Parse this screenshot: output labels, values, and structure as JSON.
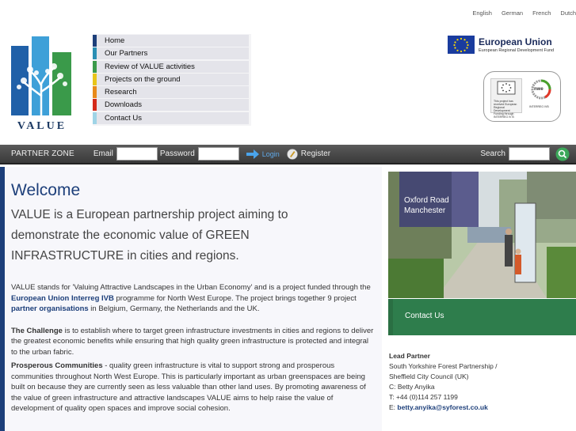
{
  "languages": [
    "English",
    "German",
    "French",
    "Dutch"
  ],
  "logo": {
    "caption": "VALUE"
  },
  "nav": {
    "items": [
      {
        "label": "Home",
        "color": "#1d3f7a"
      },
      {
        "label": "Our Partners",
        "color": "#2a8fb4"
      },
      {
        "label": "Review of VALUE activities",
        "color": "#3a9a4a"
      },
      {
        "label": "Projects on the ground",
        "color": "#e8c51a"
      },
      {
        "label": "Research",
        "color": "#e88a1a"
      },
      {
        "label": "Downloads",
        "color": "#d42a1a"
      },
      {
        "label": "Contact Us",
        "color": "#9fd4e6"
      }
    ]
  },
  "eu": {
    "title": "European Union",
    "subtitle": "European Regional Development Fund"
  },
  "badge": {
    "left_text": "This project has received European Regional Development Funding through INTERREG IV B",
    "right_text": "INTERREG IVB",
    "mark": "nwe"
  },
  "partner_bar": {
    "zone": "PARTNER ZONE",
    "email_label": "Email",
    "password_label": "Password",
    "login_label": "Login",
    "register_label": "Register",
    "search_label": "Search"
  },
  "main": {
    "title": "Welcome",
    "lead": "VALUE is a European partnership project aiming to demonstrate the economic value of GREEN INFRASTRUCTURE in cities and regions.",
    "para1_a": "VALUE stands for 'Valuing Attractive Landscapes in the Urban Economy' and is a project funded through the ",
    "para1_link1": "European Union Interreg IVB",
    "para1_b": " programme for North West Europe.  The project brings together 9 project ",
    "para1_link2": "partner organisations",
    "para1_c": " in Belgium, Germany, the Netherlands and the UK.",
    "challenge_head": "The Challenge",
    "challenge_text": " is to establish where to target green infrastructure investments in cities and regions to deliver the greatest economic benefits while ensuring that high quality green infrastructure is protected and integral to the urban fabric.",
    "prosperous_head": "Prosperous Communities",
    "prosperous_text": " - quality green infrastructure is vital to support strong and prosperous communities throughout North West Europe.  This is particularly important as urban greenspaces are being built on because they are currently seen as less valuable than other land uses.  By promoting awareness of the value of green infrastructure and attractive landscapes VALUE aims to help raise the value of development of quality open spaces and improve social cohesion."
  },
  "photo": {
    "caption_line1": "Oxford Road",
    "caption_line2": "Manchester"
  },
  "contact_tile": "Contact Us",
  "lead_partner": {
    "heading": "Lead Partner",
    "line1": "South Yorkshire Forest Partnership /",
    "line2": "Sheffield City Council (UK)",
    "contact": "C: Betty Anyika",
    "phone": "T: +44 (0)114 257 1199",
    "email_prefix": "E: ",
    "email": "betty.anyika@syforest.co.uk"
  }
}
